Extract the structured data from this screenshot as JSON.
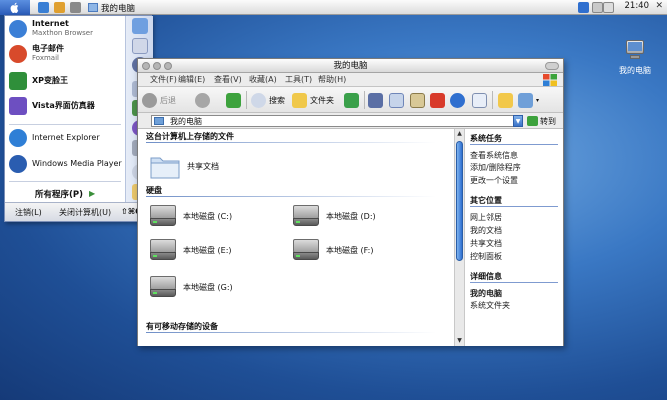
{
  "menubar": {
    "window_title": "我的电脑",
    "clock": "21:40"
  },
  "desktop": {
    "icon_label": "我的电脑"
  },
  "start_menu": {
    "items": [
      {
        "title": "Internet",
        "subtitle": "Maxthon Browser",
        "icon": "maxthon-icon",
        "color": "#3b7fd6"
      },
      {
        "title": "电子邮件",
        "subtitle": "Foxmail",
        "icon": "foxmail-icon",
        "color": "#d84a2b"
      },
      {
        "title": "XP变脸王",
        "subtitle": "",
        "icon": "xp-changer-icon",
        "color": "#2f8f3a"
      },
      {
        "title": "Vista界面仿真器",
        "subtitle": "",
        "icon": "vista-emulator-icon",
        "color": "#6d4fc1"
      },
      {
        "title": "Internet Explorer",
        "subtitle": "",
        "icon": "ie-icon",
        "color": "#2f7fd6"
      },
      {
        "title": "Windows Media Player",
        "subtitle": "",
        "icon": "media-player-icon",
        "color": "#2a5db0"
      }
    ],
    "all_programs": "所有程序(P)",
    "logout": "注销(L)",
    "shutdown": "关闭计算机(U)",
    "shortcut": "⇧⌘Q"
  },
  "window": {
    "title": "我的电脑",
    "menu": [
      "文件(F)",
      "编辑(E)",
      "查看(V)",
      "收藏(A)",
      "工具(T)",
      "帮助(H)"
    ],
    "toolbar": {
      "back": "后退",
      "search": "搜索",
      "folders": "文件夹"
    },
    "address": "我的电脑",
    "go": "转到",
    "sections": {
      "stored": "这台计算机上存储的文件",
      "hdd": "硬盘",
      "removable": "有可移动存储的设备"
    },
    "shared_docs": "共享文档",
    "drives": [
      "本地磁盘 (C:)",
      "本地磁盘 (D:)",
      "本地磁盘 (E:)",
      "本地磁盘 (F:)",
      "本地磁盘 (G:)"
    ]
  },
  "task_pane": {
    "system_tasks": {
      "header": "系统任务",
      "items": [
        "查看系统信息",
        "添加/删除程序",
        "更改一个设置"
      ]
    },
    "other_places": {
      "header": "其它位置",
      "items": [
        "网上邻居",
        "我的文档",
        "共享文档",
        "控制面板"
      ]
    },
    "details": {
      "header": "详细信息",
      "items": [
        "我的电脑",
        "系统文件夹"
      ]
    }
  }
}
